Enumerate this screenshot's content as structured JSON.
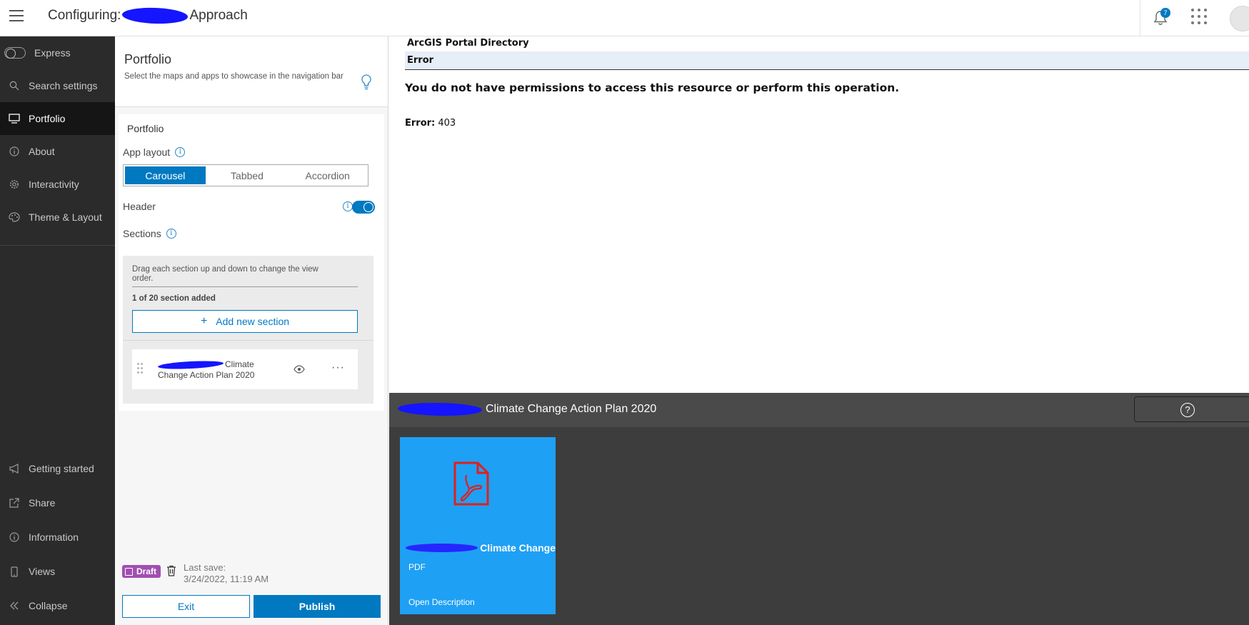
{
  "header": {
    "title_prefix": "Configuring:",
    "title_suffix": "Approach",
    "notification_count": "7"
  },
  "nav": {
    "express_label": "Express",
    "items": [
      {
        "label": "Search settings",
        "icon": "search-icon"
      },
      {
        "label": "Portfolio",
        "icon": "monitor-icon",
        "active": true
      },
      {
        "label": "About",
        "icon": "info-icon"
      },
      {
        "label": "Interactivity",
        "icon": "gear-icon"
      },
      {
        "label": "Theme & Layout",
        "icon": "palette-icon"
      }
    ],
    "bottom_items": [
      {
        "label": "Getting started",
        "icon": "megaphone-icon"
      },
      {
        "label": "Share",
        "icon": "share-icon"
      },
      {
        "label": "Information",
        "icon": "info-icon"
      },
      {
        "label": "Views",
        "icon": "phone-icon"
      },
      {
        "label": "Collapse",
        "icon": "double-chevron-left-icon"
      }
    ]
  },
  "panel": {
    "title": "Portfolio",
    "description": "Select the maps and apps to showcase in the navigation bar",
    "card_title": "Portfolio",
    "app_layout_label": "App layout",
    "layout_options": [
      "Carousel",
      "Tabbed",
      "Accordion"
    ],
    "selected_layout": "Carousel",
    "header_label": "Header",
    "header_enabled": true,
    "sections_label": "Sections",
    "sections_help": "Drag each section up and down to change the view order.",
    "sections_count": "1 of 20 section added",
    "add_section_label": "Add new section",
    "section_item_text_1": "Climate",
    "section_item_text_2": "Change Action Plan 2020",
    "draft_label": "Draft",
    "last_save_label": "Last save:",
    "last_save_time": "3/24/2022, 11:19 AM",
    "exit_label": "Exit",
    "publish_label": "Publish"
  },
  "preview": {
    "directory_title": "ArcGIS Portal Directory",
    "error_heading": "Error",
    "error_message": "You do not have permissions to access this resource or perform this operation.",
    "error_code_label": "Error:",
    "error_code_value": "403",
    "viewer_title": "Climate Change Action Plan 2020",
    "tile_name": "Climate Change",
    "tile_type": "PDF",
    "tile_link": "Open Description"
  },
  "colors": {
    "accent": "#0079c1",
    "nav_bg": "#2b2b2b",
    "draft_badge": "#a14fb1",
    "tile_bg": "#1ea0f4",
    "pdf_icon": "#e0201b",
    "redaction": "#1515ff"
  }
}
